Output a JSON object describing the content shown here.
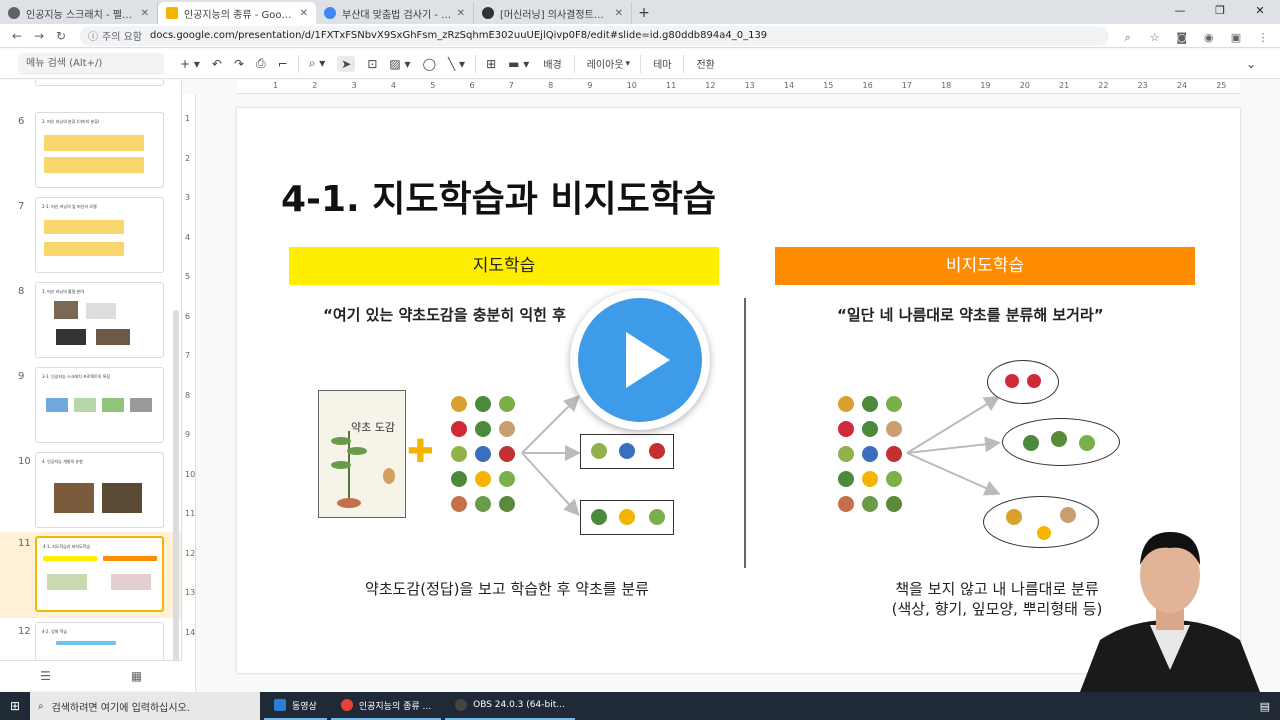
{
  "browser": {
    "tabs": [
      {
        "title": "인공지능 스크래치 - 펠로소프트",
        "active": false,
        "fav_color": "#5f6368"
      },
      {
        "title": "인공지능의 종류 - Google 프레...",
        "active": true,
        "fav_color": "#f4b400"
      },
      {
        "title": "부산대 맞춤법 검사기 - Google ...",
        "active": false,
        "fav_color": "#4285f4"
      },
      {
        "title": "[머신러닝] 의사결정트리 (Decisi...",
        "active": false,
        "fav_color": "#333333"
      }
    ],
    "new_tab": "+",
    "security": "주의 요함",
    "url": "docs.google.com/presentation/d/1FXTxFSNbvX9SxGhFsm_zRzSqhmE302uuUEjlQivp0F8/edit#slide=id.g80ddb894a4_0_139"
  },
  "toolbar": {
    "menu_search": "메뉴 검색 (Alt+/)",
    "background": "배경",
    "layout": "레이아웃",
    "theme": "테마",
    "transition": "전환"
  },
  "filmstrip": {
    "slides": [
      {
        "num": "6",
        "label": "2. 머신 러닝의 분류 (이미지 분류)"
      },
      {
        "num": "7",
        "label": "2-1. 머신 러닝의 앞 머신러 모델"
      },
      {
        "num": "8",
        "label": "3. 머신 러닝의 활용 분야"
      },
      {
        "num": "9",
        "label": "3-1. 인공지능 스크래치 프로젝트의 특징"
      },
      {
        "num": "10",
        "label": "4. 인공지능 개발의 유형"
      },
      {
        "num": "11",
        "label": "4-1. 지도학습과 비지도학습"
      },
      {
        "num": "12",
        "label": "4-2. 강화 학습"
      }
    ],
    "active_index": 5
  },
  "ruler": {
    "h_ticks": [
      "1",
      "2",
      "3",
      "4",
      "5",
      "6",
      "7",
      "8",
      "9",
      "10",
      "11",
      "12",
      "13",
      "14",
      "15",
      "16",
      "17",
      "18",
      "19",
      "20",
      "21",
      "22",
      "23",
      "24",
      "25"
    ],
    "v_ticks": [
      "1",
      "2",
      "3",
      "4",
      "5",
      "6",
      "7",
      "8",
      "9",
      "10",
      "11",
      "12",
      "13",
      "14"
    ]
  },
  "slide": {
    "title": "4-1. 지도학습과 비지도학습",
    "left": {
      "header": "지도학습",
      "header_color": "#ffee00",
      "quote": "“여기 있는 약초도감을 충분히 익힌 후",
      "book_title": "약초 도감",
      "caption": "약초도감(정답)을 보고 학습한 후 약초를 분류"
    },
    "right": {
      "header": "비지도학습",
      "header_color": "#ff8c00",
      "quote": "“일단 네 나름대로 약초를 분류해 보거라”",
      "caption_line1": "책을 보지 않고 내 나름대로 분류",
      "caption_line2": "(색상, 향기, 잎모양, 뿌리형태 등)"
    }
  },
  "taskbar": {
    "search": "검색하려면 여기에 입력하십시오.",
    "tasks": [
      {
        "label": "동영상",
        "color": "#2b7cd3"
      },
      {
        "label": "인공지능의 종류 ...",
        "color": "#e94235"
      },
      {
        "label": "OBS 24.0.3 (64-bit...",
        "color": "#444444"
      }
    ]
  }
}
